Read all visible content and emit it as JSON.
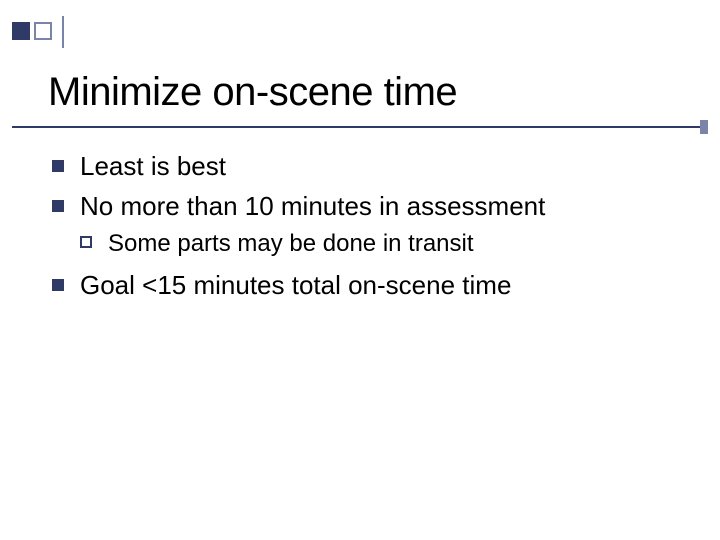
{
  "slide": {
    "title": "Minimize on-scene time",
    "bullets": {
      "b1": "Least is best",
      "b2": "No more than 10 minutes in assessment",
      "b2_sub1": "Some parts may be done in transit",
      "b3": "Goal <15 minutes total on-scene time"
    }
  }
}
